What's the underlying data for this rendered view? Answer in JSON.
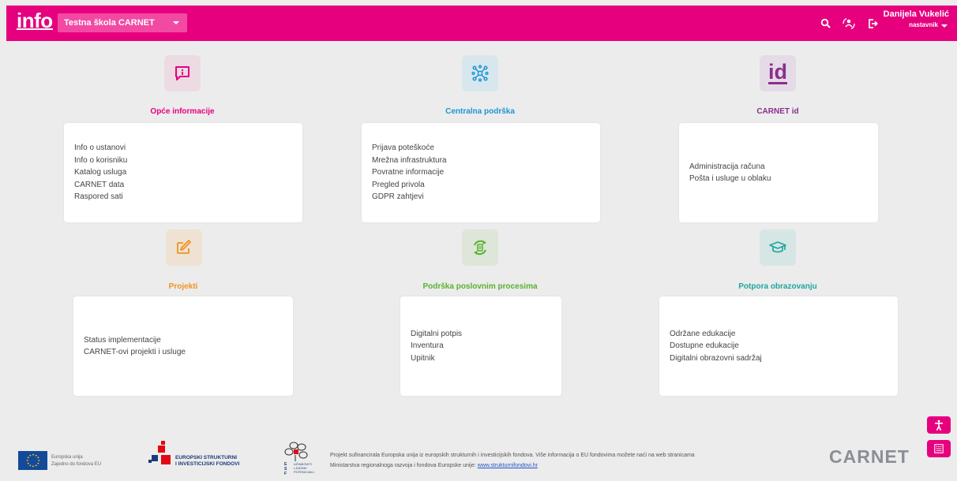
{
  "header": {
    "logo": "info",
    "school": "Testna škola CARNET",
    "user_name": "Danijela Vukelić",
    "user_role": "nastavnik"
  },
  "sections": [
    {
      "title": "Opće informacije",
      "color": "#e6007e",
      "icon": "info-message-icon",
      "items": [
        "Info o ustanovi",
        "Info o korisniku",
        "Katalog usluga",
        "CARNET data",
        "Raspored sati"
      ]
    },
    {
      "title": "Centralna podrška",
      "color": "#1a96d4",
      "icon": "network-icon",
      "items": [
        "Prijava poteškoće",
        "Mrežna infrastruktura",
        "Povratne informacije",
        "Pregled privola",
        "GDPR zahtjevi"
      ]
    },
    {
      "title": "CARNET id",
      "color": "#8a2f8c",
      "icon": "id-icon",
      "id_glyph": "id",
      "items": [
        "Administracija računa",
        "Pošta i usluge u oblaku"
      ]
    },
    {
      "title": "Projekti",
      "color": "#f29221",
      "icon": "project-edit-icon",
      "items": [
        "Status implementacije",
        "CARNET-ovi projekti i usluge"
      ]
    },
    {
      "title": "Podrška poslovnim procesima",
      "color": "#5ab031",
      "icon": "process-cycle-icon",
      "items": [
        "Digitalni potpis",
        "Inventura",
        "Upitnik"
      ]
    },
    {
      "title": "Potpora obrazovanju",
      "color": "#1fa6a0",
      "icon": "graduation-cap-icon",
      "items": [
        "Održane edukacije",
        "Dostupne edukacije",
        "Digitalni obrazovni sadržaj"
      ]
    }
  ],
  "footer": {
    "eu_line1": "Europska unija",
    "eu_line2": "Zajedno do fondova EU",
    "esif_line1": "EUROPSKI STRUKTURNI",
    "esif_line2": "I INVESTICIJSKI FONDOVI",
    "ulj_text": "UČINKOVITI LJUDSKI POTENCIJALI",
    "text_line1": "Projekt sufinancirala Europska unija iz europskih strukturnih i investicijskih fondova. Više informacija o EU fondovima možete naći na web stranicama",
    "text_line2": "Ministarstva regionalnoga razvoja i fondova Europske unije:",
    "link": "www.strukturnifondovi.hr",
    "carnet_logo": "CARNET"
  }
}
